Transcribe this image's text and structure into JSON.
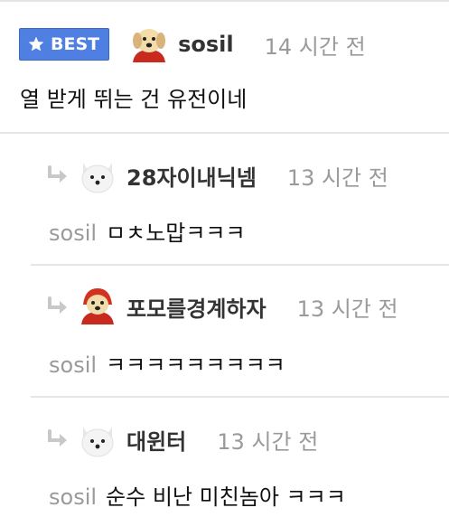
{
  "best_comment": {
    "badge_label": "BEST",
    "author": "sosil",
    "time": "14 시간 전",
    "body": "열 받게 뛰는 건 유전이네"
  },
  "replies": [
    {
      "author": "28자이내닉넴",
      "time": "13 시간 전",
      "mention": "sosil",
      "body": "ㅁㅊ노맙ㅋㅋㅋ",
      "avatar": "white-fox-avatar"
    },
    {
      "author": "포모를경계하자",
      "time": "13 시간 전",
      "mention": "sosil",
      "body": "ㅋㅋㅋㅋㅋㅋㅋㅋㅋ",
      "avatar": "puppy-red-hood-avatar"
    },
    {
      "author": "대윈터",
      "time": "13 시간 전",
      "mention": "sosil",
      "body": "순수 비난 미친놈아 ㅋㅋㅋ",
      "avatar": "white-fox-avatar"
    }
  ],
  "colors": {
    "badge": "#4f7fe0",
    "muted": "#9a9a9a",
    "divider": "#e6e6e6"
  }
}
